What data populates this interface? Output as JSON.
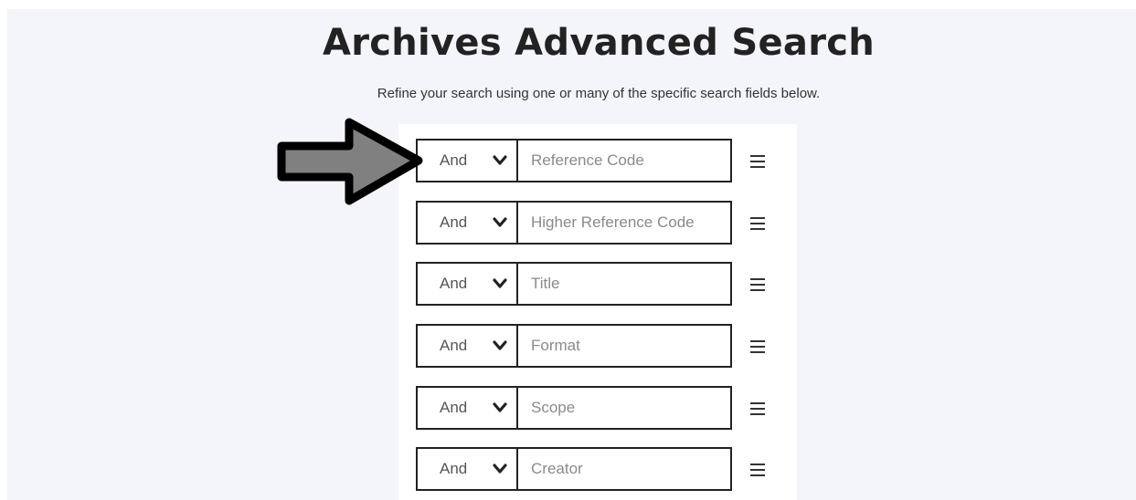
{
  "header": {
    "title": "Archives Advanced Search",
    "subtitle": "Refine your search using one or many of the specific search fields below."
  },
  "rows": [
    {
      "operator": "And",
      "placeholder": "Reference Code",
      "value": ""
    },
    {
      "operator": "And",
      "placeholder": "Higher Reference Code",
      "value": ""
    },
    {
      "operator": "And",
      "placeholder": "Title",
      "value": ""
    },
    {
      "operator": "And",
      "placeholder": "Format",
      "value": ""
    },
    {
      "operator": "And",
      "placeholder": "Scope",
      "value": ""
    },
    {
      "operator": "And",
      "placeholder": "Creator",
      "value": ""
    }
  ],
  "icons": {
    "operator_dropdown": "chevron-down-icon",
    "row_handle": "hamburger-menu-icon",
    "annotation": "right-arrow-icon"
  },
  "colors": {
    "page_background": "#f4f5fb",
    "form_background": "#ffffff",
    "border": "#222222",
    "placeholder_text": "#8a8a8a",
    "annotation_arrow_fill": "#808080"
  }
}
